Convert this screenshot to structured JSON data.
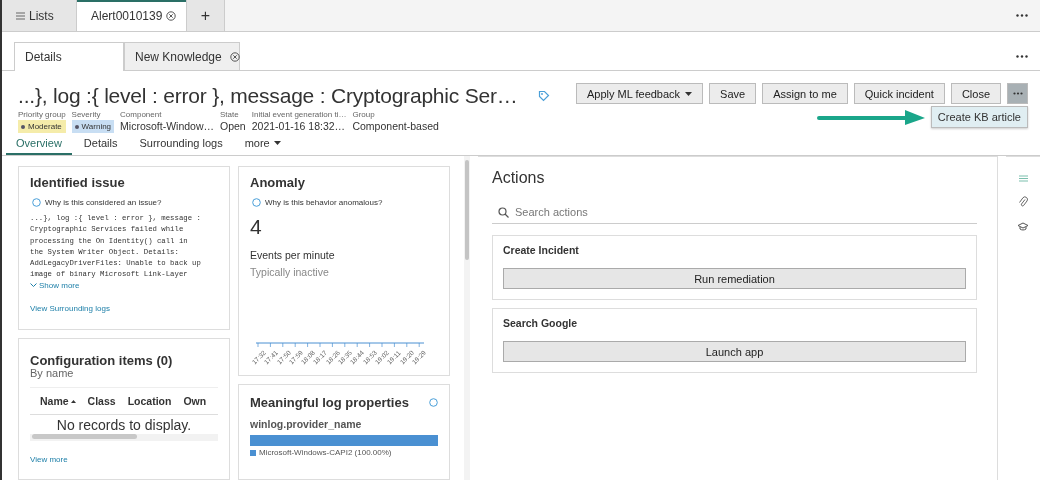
{
  "top_tabs": [
    {
      "label": "Lists",
      "kind": "list",
      "selected": false
    },
    {
      "label": "Alert0010139",
      "kind": "closable",
      "selected": true
    },
    {
      "label": "+",
      "kind": "add",
      "selected": false
    }
  ],
  "detail_tabs": [
    {
      "label": "Details",
      "closable": false,
      "selected": true
    },
    {
      "label": "New Knowledge",
      "closable": true,
      "selected": false
    }
  ],
  "title": "...}, log :{ level : error }, message : Cryptographic Ser…",
  "toolbar": [
    {
      "label": "Apply ML feedback",
      "kind": "dropdown"
    },
    {
      "label": "Save",
      "kind": "button"
    },
    {
      "label": "Assign to me",
      "kind": "button"
    },
    {
      "label": "Quick incident",
      "kind": "button"
    },
    {
      "label": "Close",
      "kind": "button"
    }
  ],
  "more_menu": {
    "expanded": true,
    "items": [
      "Create KB article"
    ]
  },
  "fields": [
    {
      "label": "Priority group",
      "value": "Moderate",
      "kind": "badge",
      "color": "#f5ecaa"
    },
    {
      "label": "Severity",
      "value": "Warning",
      "kind": "badge",
      "color": "#c8def3"
    },
    {
      "label": "Component",
      "value": "Microsoft-Window…",
      "kind": "text"
    },
    {
      "label": "State",
      "value": "Open",
      "kind": "text"
    },
    {
      "label": "Initial event generation ti…",
      "value": "2021-01-16 18:32…",
      "kind": "text"
    },
    {
      "label": "Group",
      "value": "Component-based",
      "kind": "text"
    }
  ],
  "sub_tabs": [
    {
      "label": "Overview",
      "kind": "tab",
      "selected": true
    },
    {
      "label": "Details",
      "kind": "tab",
      "selected": false
    },
    {
      "label": "Surrounding logs",
      "kind": "tab",
      "selected": false
    },
    {
      "label": "more",
      "kind": "dropdown",
      "selected": false
    }
  ],
  "identified_issue": {
    "title": "Identified issue",
    "hint": "Why is this considered an issue?",
    "log_lines": [
      "...}, log :{ level : error }, message :",
      "Cryptographic Services failed while",
      "processing the On Identity() call in",
      "the System Writer Object. Details:",
      "AddLegacyDriverFiles: Unable to back up",
      "image of binary Microsoft Link-Layer"
    ],
    "show_more": "Show more",
    "link": "View Surrounding logs"
  },
  "configuration_items": {
    "title": "Configuration items (0)",
    "subtitle": "By name",
    "columns": [
      {
        "label": "Name",
        "sorted": true
      },
      {
        "label": "Class",
        "sorted": false
      },
      {
        "label": "Location",
        "sorted": false
      },
      {
        "label": "Own",
        "sorted": false
      }
    ],
    "empty": "No records to display.",
    "link": "View more"
  },
  "anomaly": {
    "title": "Anomaly",
    "hint": "Why is this behavior anomalous?",
    "value": "4",
    "unit": "Events per minute",
    "note": "Typically inactive",
    "time_labels": [
      "17:32",
      "17:41",
      "17:50",
      "17:59",
      "18:08",
      "18:17",
      "18:26",
      "18:35",
      "18:44",
      "18:53",
      "19:02",
      "19:11",
      "19:20",
      "19:29"
    ]
  },
  "log_properties": {
    "title": "Meaningful log properties",
    "property": "winlog.provider_name",
    "bars": [
      {
        "legend": "Microsoft-Windows-CAPI2 (100.00%)",
        "level": 1,
        "color": "#4a90d2"
      }
    ]
  },
  "actions": {
    "title": "Actions",
    "search_placeholder": "Search actions",
    "groups": [
      {
        "title": "Create Incident",
        "button": "Run remediation"
      },
      {
        "title": "Search Google",
        "button": "Launch app"
      }
    ]
  }
}
